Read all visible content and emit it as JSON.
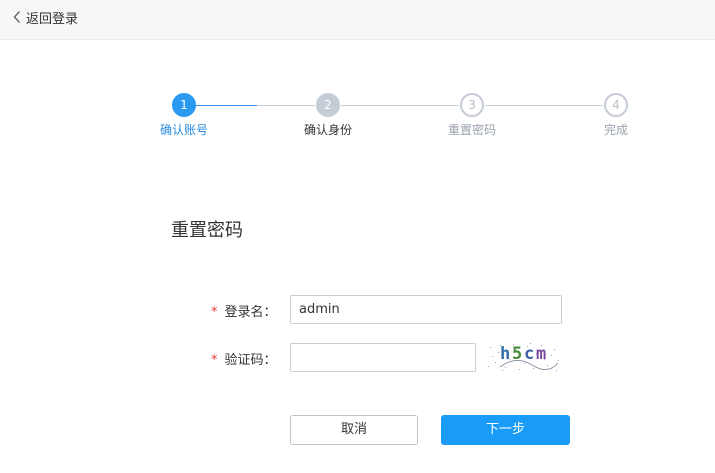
{
  "header": {
    "back_label": "返回登录",
    "back_icon": "chevron-left-icon"
  },
  "steps": [
    {
      "number": "1",
      "label": "确认账号",
      "state": "active"
    },
    {
      "number": "2",
      "label": "确认身份",
      "state": "grey"
    },
    {
      "number": "3",
      "label": "重置密码",
      "state": "todo"
    },
    {
      "number": "4",
      "label": "完成",
      "state": "todo"
    }
  ],
  "form": {
    "title": "重置密码",
    "required_mark": "*",
    "username": {
      "label": "登录名：",
      "value": "admin"
    },
    "captcha": {
      "label": "验证码：",
      "value": "",
      "image_text": "h5cm"
    }
  },
  "buttons": {
    "cancel": "取消",
    "next": "下一步"
  },
  "colors": {
    "accent": "#1a9bf7",
    "step_done": "#2a9af0",
    "step_pending": "#c5ccd6",
    "required": "#e23c3c"
  }
}
